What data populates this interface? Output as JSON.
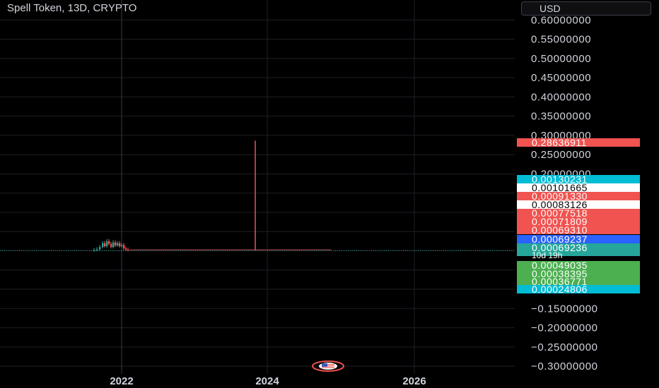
{
  "header": {
    "title": "Spell Token, 13D, CRYPTO",
    "currency_label": "USD"
  },
  "colors": {
    "background": "#000000",
    "grid": "#1c1f26",
    "text": "#d1d4dc",
    "up": "#26a69a",
    "down": "#ef5350",
    "blue": "#2962ff",
    "cyan": "#00bcd4",
    "white": "#ffffff",
    "green": "#4caf50",
    "red_label": "#f05350"
  },
  "chart_data": {
    "type": "candlestick",
    "y_range": [
      -0.32,
      0.63
    ],
    "y_ticks": [
      0.6,
      0.55,
      0.5,
      0.45,
      0.4,
      0.35,
      0.3,
      0.25,
      0.2,
      -0.15,
      -0.2,
      -0.25,
      -0.3
    ],
    "y_tick_labels": [
      "0.60000000",
      "0.55000000",
      "0.50000000",
      "0.45000000",
      "0.40000000",
      "0.35000000",
      "0.30000000",
      "0.25000000",
      "0.20000000",
      "−0.15000000",
      "−0.20000000",
      "−0.25000000",
      "−0.30000000"
    ],
    "x_ticks": [
      "2022",
      "2024",
      "2026"
    ],
    "current_price": 0.00069237,
    "spike": {
      "date": "2023-11",
      "high": 0.28636911
    },
    "price_labels": [
      {
        "text": "0.28636911",
        "color": "red",
        "value": 0.28636911
      },
      {
        "text": "0.00130231",
        "color": "cyan",
        "value": 0.00130231
      },
      {
        "text": "0.00101665",
        "color": "white",
        "value": 0.00101665
      },
      {
        "text": "0.00091330",
        "color": "red",
        "value": 0.0009133
      },
      {
        "text": "0.00083126",
        "color": "white",
        "value": 0.00083126
      },
      {
        "text": "0.00077518",
        "color": "red",
        "value": 0.00077518
      },
      {
        "text": "0.00071809",
        "color": "red",
        "value": 0.00071809
      },
      {
        "text": "0.00069310",
        "color": "red",
        "value": 0.0006931
      },
      {
        "text": "0.00069237",
        "color": "blue",
        "value": 0.00069237
      },
      {
        "text": "0.00069236",
        "sub": "10d 19h",
        "color": "up",
        "value": 0.00069236
      },
      {
        "text": "0.00049035",
        "color": "green",
        "value": 0.00049035
      },
      {
        "text": "0.00038395",
        "color": "green",
        "value": 0.00038395
      },
      {
        "text": "0.00036771",
        "color": "green",
        "value": 0.00036771
      },
      {
        "text": "0.00024806",
        "color": "cyan",
        "value": 0.00024806
      }
    ]
  }
}
